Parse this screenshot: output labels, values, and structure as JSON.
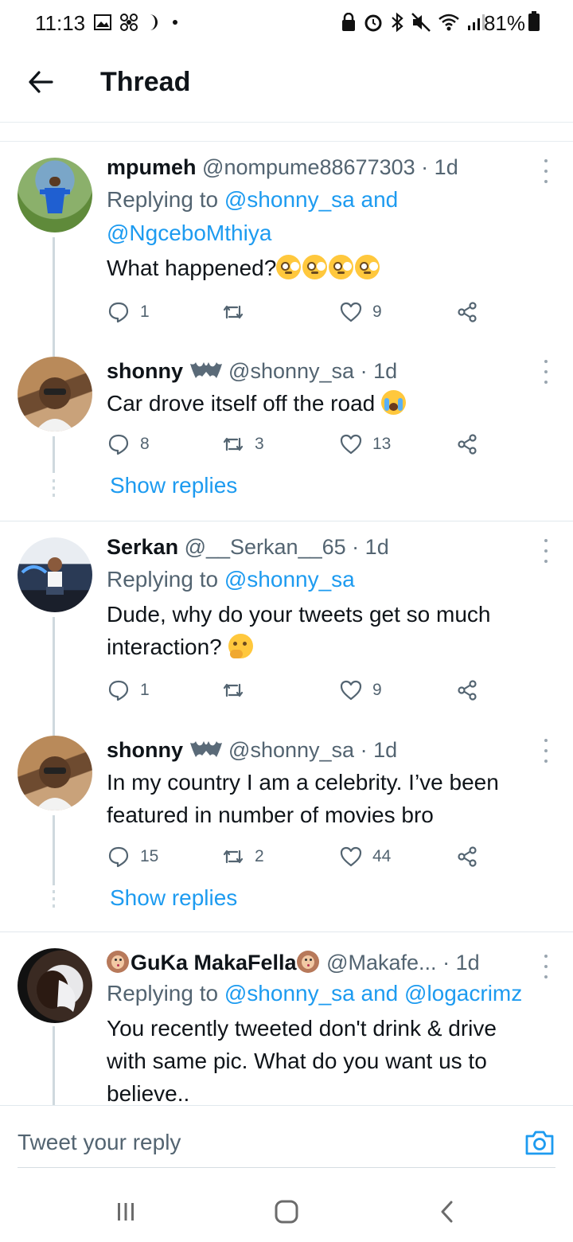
{
  "status_bar": {
    "time": "11:13",
    "battery": "81%"
  },
  "header": {
    "title": "Thread"
  },
  "tweets": [
    {
      "name": "mpumeh",
      "handle": "@nompume88677303",
      "sep": "·",
      "time": "1d",
      "reply_prefix": "Replying to",
      "reply_mentions": [
        "@shonny_sa",
        "@NgceboMthiya"
      ],
      "reply_and": "and",
      "text": "What happened?",
      "emoji": "flushed-face",
      "actions": {
        "replies": "1",
        "retweets": "",
        "likes": "9"
      }
    },
    {
      "name": "shonny",
      "handle": "@shonny_sa",
      "sep": "·",
      "time": "1d",
      "text": "Car drove itself off the road",
      "emoji": "loudly-crying-face",
      "actions": {
        "replies": "8",
        "retweets": "3",
        "likes": "13"
      },
      "show_replies": "Show replies"
    },
    {
      "name": "Serkan",
      "handle": "@__Serkan__65",
      "sep": "·",
      "time": "1d",
      "reply_prefix": "Replying to",
      "reply_mentions": [
        "@shonny_sa"
      ],
      "text_line1": "Dude, why do your tweets get so much",
      "text_line2": "interaction?",
      "emoji": "thinking-face",
      "actions": {
        "replies": "1",
        "retweets": "",
        "likes": "9"
      }
    },
    {
      "name": "shonny",
      "handle": "@shonny_sa",
      "sep": "·",
      "time": "1d",
      "text_line1": "In my country I am a celebrity. I’ve been",
      "text_line2": "featured in number of movies bro",
      "actions": {
        "replies": "15",
        "retweets": "2",
        "likes": "44"
      },
      "show_replies": "Show replies"
    },
    {
      "name": "GuKa MakaFella",
      "handle": "@Makafe...",
      "sep": "·",
      "time": "1d",
      "reply_prefix": "Replying to",
      "reply_mentions": [
        "@shonny_sa",
        "@logacrimz"
      ],
      "reply_and": "and",
      "text_line1": "You recently tweeted don't drink & drive",
      "text_line2": "with same pic. What do you want us to",
      "text_line3": "believe..",
      "emoji": "monkey-face"
    }
  ],
  "reply_bar": {
    "placeholder": "Tweet your reply"
  },
  "icons": {
    "accent": "#1d9bf0",
    "muted": "#536471",
    "like": "heart-icon",
    "reply": "speech-bubble-icon",
    "retweet": "retweet-icon",
    "share": "share-icon",
    "camera": "camera-icon"
  }
}
